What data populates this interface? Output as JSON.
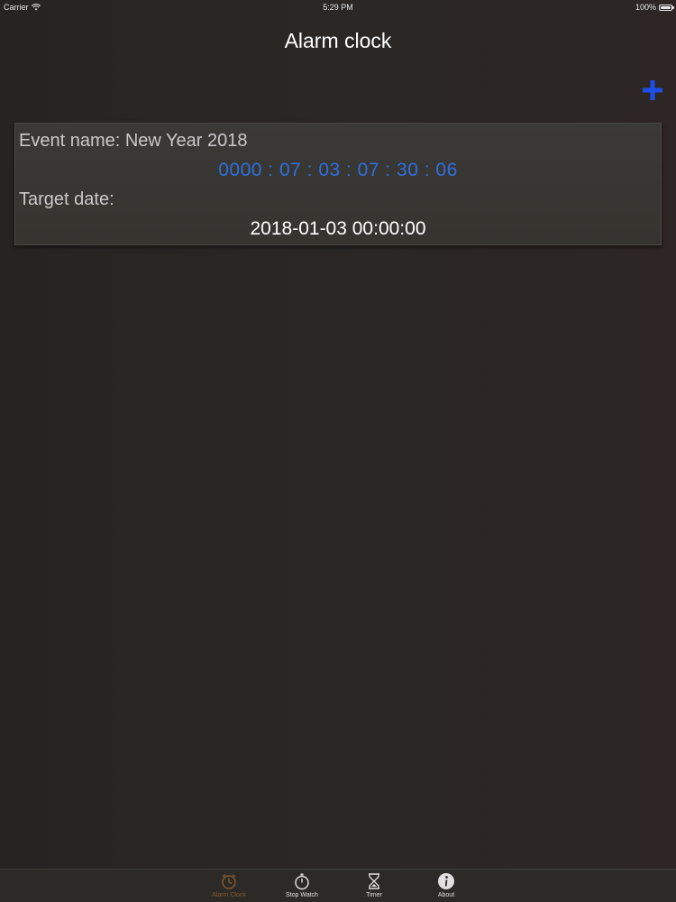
{
  "status_bar": {
    "carrier": "Carrier",
    "time": "5:29 PM",
    "battery_percent": "100%",
    "battery_level": 1.0
  },
  "nav": {
    "title": "Alarm clock",
    "add_icon": "plus-icon"
  },
  "event": {
    "name_label": "Event name: New Year 2018",
    "countdown": "0000 : 07 : 03 : 07 : 30 : 06",
    "target_label": "Target date:",
    "target_date": "2018-01-03 00:00:00"
  },
  "tabs": [
    {
      "label": "Alarm Clock",
      "icon": "alarm-clock-icon",
      "active": true
    },
    {
      "label": "Stop Watch",
      "icon": "stopwatch-icon",
      "active": false
    },
    {
      "label": "Timer",
      "icon": "hourglass-icon",
      "active": false
    },
    {
      "label": "About",
      "icon": "info-icon",
      "active": false
    }
  ],
  "colors": {
    "background": "#2a2725",
    "countdown": "#2f6fe0",
    "add_button": "#1a4fe8",
    "active_tab": "#8a5a2a"
  }
}
